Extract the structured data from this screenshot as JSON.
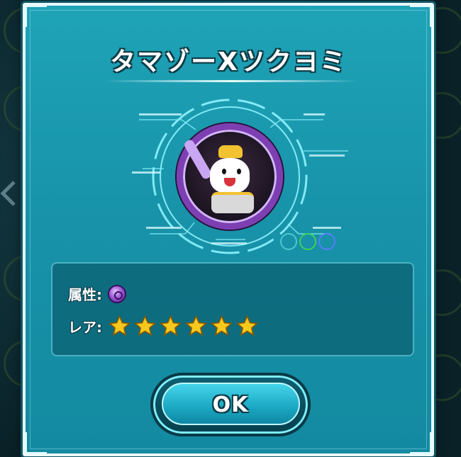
{
  "dialog": {
    "title": "タマゾーXツクヨミ",
    "attribute_label": "属性:",
    "attribute_icon": "dark-attribute-icon",
    "rarity_label": "レア:",
    "rarity_stars": 6,
    "ok_label": "OK"
  },
  "colors": {
    "panel": "#1fa3b7",
    "frame_accent": "#7e3fb3",
    "star": "#f7c81e"
  }
}
